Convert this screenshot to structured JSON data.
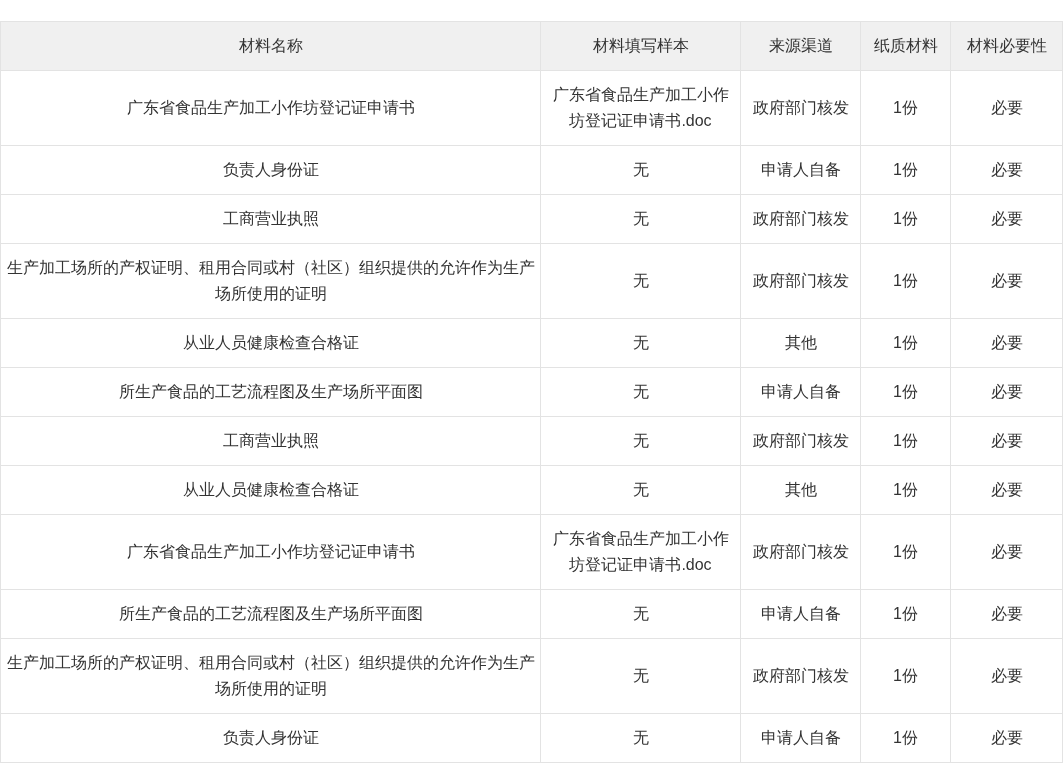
{
  "table": {
    "columns": [
      "材料名称",
      "材料填写样本",
      "来源渠道",
      "纸质材料",
      "材料必要性"
    ],
    "rows": [
      [
        "广东省食品生产加工小作坊登记证申请书",
        "广东省食品生产加工小作坊登记证申请书.doc",
        "政府部门核发",
        "1份",
        "必要"
      ],
      [
        "负责人身份证",
        "无",
        "申请人自备",
        "1份",
        "必要"
      ],
      [
        "工商营业执照",
        "无",
        "政府部门核发",
        "1份",
        "必要"
      ],
      [
        "生产加工场所的产权证明、租用合同或村（社区）组织提供的允许作为生产场所使用的证明",
        "无",
        "政府部门核发",
        "1份",
        "必要"
      ],
      [
        "从业人员健康检查合格证",
        "无",
        "其他",
        "1份",
        "必要"
      ],
      [
        "所生产食品的工艺流程图及生产场所平面图",
        "无",
        "申请人自备",
        "1份",
        "必要"
      ],
      [
        "工商营业执照",
        "无",
        "政府部门核发",
        "1份",
        "必要"
      ],
      [
        "从业人员健康检查合格证",
        "无",
        "其他",
        "1份",
        "必要"
      ],
      [
        "广东省食品生产加工小作坊登记证申请书",
        "广东省食品生产加工小作坊登记证申请书.doc",
        "政府部门核发",
        "1份",
        "必要"
      ],
      [
        "所生产食品的工艺流程图及生产场所平面图",
        "无",
        "申请人自备",
        "1份",
        "必要"
      ],
      [
        "生产加工场所的产权证明、租用合同或村（社区）组织提供的允许作为生产场所使用的证明",
        "无",
        "政府部门核发",
        "1份",
        "必要"
      ],
      [
        "负责人身份证",
        "无",
        "申请人自备",
        "1份",
        "必要"
      ]
    ]
  }
}
